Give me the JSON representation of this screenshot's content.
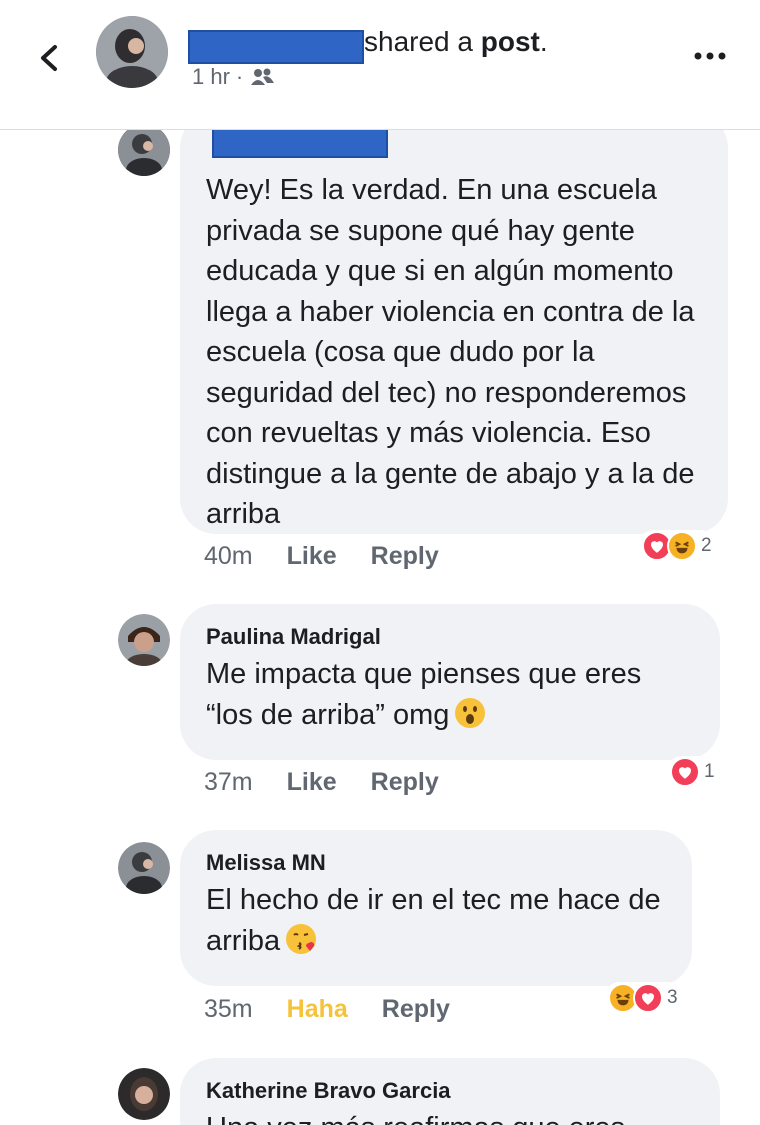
{
  "header": {
    "action_text": "shared a ",
    "action_object": "post",
    "action_suffix": ".",
    "time": "1 hr",
    "separator": "·",
    "audience_icon": "friends-icon",
    "more_icon": "more-horizontal-icon",
    "back_icon": "chevron-left-icon"
  },
  "comments": [
    {
      "name": "",
      "text": "Wey! Es la verdad. En una escuela privada se supone qué hay gente educada y que si en algún momento llega a haber violencia en contra de la escuela (cosa que dudo por la seguridad del tec) no responderemos con revueltas y más violencia. Eso distingue a la gente de abajo y a la de arriba",
      "time": "40m",
      "like_label": "Like",
      "reply_label": "Reply",
      "reactions": [
        "love",
        "haha"
      ],
      "reaction_count": "2"
    },
    {
      "name": "Paulina Madrigal",
      "text": "Me impacta que pienses que eres “los de arriba” omg",
      "emoji": "astonished-face",
      "time": "37m",
      "like_label": "Like",
      "reply_label": "Reply",
      "reactions": [
        "love"
      ],
      "reaction_count": "1"
    },
    {
      "name": "Melissa MN",
      "text": "El hecho de ir en el tec me hace de arriba",
      "emoji": "face-blowing-kiss",
      "time": "35m",
      "like_label": "Haha",
      "reply_label": "Reply",
      "reactions": [
        "haha",
        "love"
      ],
      "reaction_count": "3"
    },
    {
      "name": "Katherine Bravo Garcia",
      "text": "Una vez más reafirmas que eres"
    }
  ],
  "colors": {
    "bubble": "#f0f2f5",
    "meta_text": "#606770",
    "love": "#f33e58",
    "haha": "#f7b125",
    "haha_label": "#f5c33b",
    "redaction": "#2f66c6"
  }
}
